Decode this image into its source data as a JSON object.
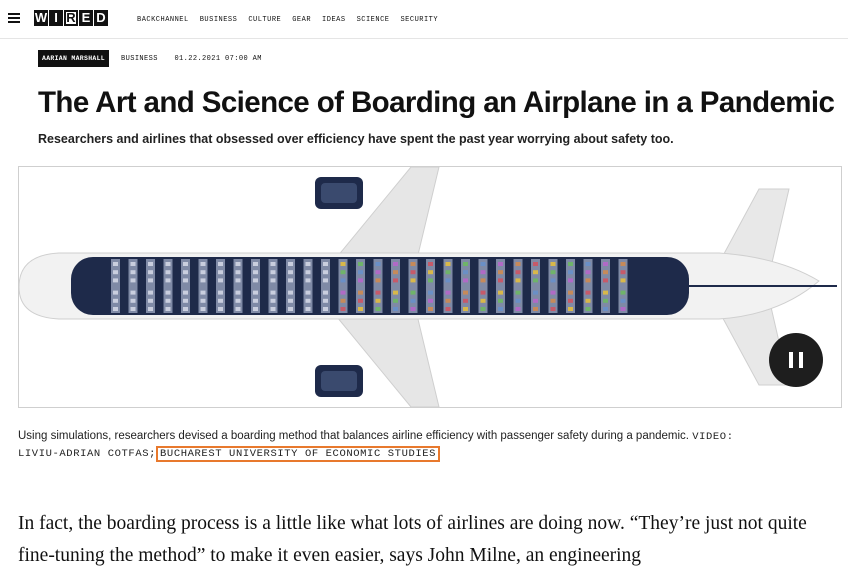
{
  "nav": {
    "menu_icon": "hamburger-icon",
    "logo_letters": [
      "W",
      "I",
      "R",
      "E",
      "D"
    ],
    "links": [
      "BACKCHANNEL",
      "BUSINESS",
      "CULTURE",
      "GEAR",
      "IDEAS",
      "SCIENCE",
      "SECURITY"
    ]
  },
  "article": {
    "author": "AARIAN MARSHALL",
    "section": "BUSINESS",
    "date": "01.22.2021 07:00 AM",
    "headline": "The Art and Science of Boarding an Airplane in a Pandemic",
    "dek": "Researchers and airlines that obsessed over efficiency have spent the past year worrying about safety too.",
    "video_control_icon": "pause-icon",
    "caption_text": "Using simulations, researchers devised a boarding method that balances airline efficiency with passenger safety during a pandemic.",
    "credit_label": "VIDEO: LIVIU-ADRIAN COTFAS;",
    "credit_org": "BUCHAREST UNIVERSITY OF ECONOMIC STUDIES",
    "body_text": "In fact, the boarding process is a little like what lots of airlines are doing now. “They’re just not quite fine-tuning the method” to make it even easier, says John Milne, an engineering"
  },
  "colors": {
    "fuselage": "#1e2a4a",
    "highlight": "#e8792d"
  }
}
